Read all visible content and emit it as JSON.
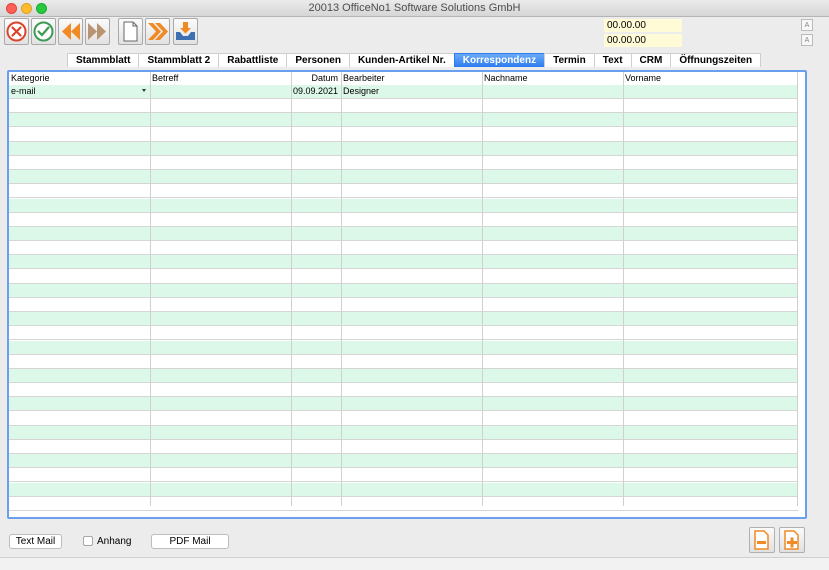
{
  "window": {
    "title": "20013 OfficeNo1 Software Solutions GmbH"
  },
  "toolbar": {
    "buttons": [
      {
        "name": "cancel-button",
        "icon": "x-circle-icon"
      },
      {
        "name": "confirm-button",
        "icon": "check-circle-icon"
      },
      {
        "name": "previous-button",
        "icon": "double-arrow-left-icon"
      },
      {
        "name": "next-button",
        "icon": "double-arrow-right-icon"
      },
      {
        "name": "new-document-button",
        "icon": "document-icon"
      },
      {
        "name": "last-button",
        "icon": "double-chevron-right-icon"
      },
      {
        "name": "download-button",
        "icon": "inbox-download-icon"
      }
    ],
    "date1": "00.00.00",
    "date2": "00.00.00"
  },
  "tabs": [
    {
      "label": "Stammblatt",
      "active": false
    },
    {
      "label": "Stammblatt 2",
      "active": false
    },
    {
      "label": "Rabattliste",
      "active": false
    },
    {
      "label": "Personen",
      "active": false
    },
    {
      "label": "Kunden-Artikel Nr.",
      "active": false
    },
    {
      "label": "Korrespondenz",
      "active": true
    },
    {
      "label": "Termin",
      "active": false
    },
    {
      "label": "Text",
      "active": false
    },
    {
      "label": "CRM",
      "active": false
    },
    {
      "label": "Öffnungszeiten",
      "active": false
    }
  ],
  "table": {
    "columns": [
      "Kategorie",
      "Betreff",
      "Datum",
      "Bearbeiter",
      "Nachname",
      "Vorname"
    ],
    "rows": [
      {
        "kategorie": "e-mail",
        "betreff": "",
        "datum": "09.09.2021",
        "bearbeiter": "Designer",
        "nachname": "",
        "vorname": ""
      }
    ]
  },
  "bottom": {
    "text_mail": "Text Mail",
    "anhang": "Anhang",
    "pdf_mail": "PDF Mail"
  }
}
